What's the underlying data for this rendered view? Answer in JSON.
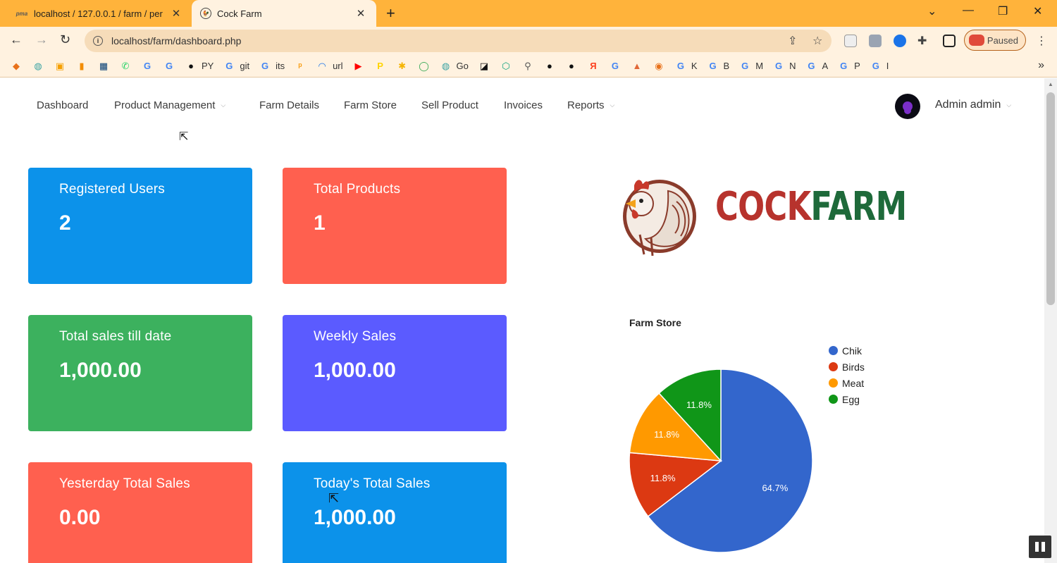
{
  "browser": {
    "tabs": [
      {
        "title": "localhost / 127.0.0.1 / farm / per",
        "favicon": "phpmyadmin-icon",
        "active": false
      },
      {
        "title": "Cock Farm",
        "favicon": "rooster-icon",
        "active": true
      }
    ],
    "url": "localhost/farm/dashboard.php",
    "profile_status": "Paused",
    "bookmarks": [
      {
        "icon": "arrows-icon",
        "label": "",
        "color": "#e8711a"
      },
      {
        "icon": "leaf-icon",
        "label": "",
        "color": "#3aa3a3"
      },
      {
        "icon": "ui-icon",
        "label": "",
        "color": "#f59f00"
      },
      {
        "icon": "bars-icon",
        "label": "",
        "color": "#f28c00"
      },
      {
        "icon": "ieee-icon",
        "label": "",
        "color": "#003b73"
      },
      {
        "icon": "whatsapp-icon",
        "label": "",
        "color": "#25d366"
      },
      {
        "icon": "google-icon",
        "label": "",
        "color": "#4285f4"
      },
      {
        "icon": "google-icon",
        "label": "",
        "color": "#4285f4"
      },
      {
        "icon": "github-icon",
        "label": "PY",
        "color": "#111111"
      },
      {
        "icon": "google-icon",
        "label": "git",
        "color": "#4285f4"
      },
      {
        "icon": "google-icon",
        "label": "its",
        "color": "#4285f4"
      },
      {
        "icon": "pma-icon",
        "label": "",
        "color": "#f89c0e"
      },
      {
        "icon": "wave-icon",
        "label": "url",
        "color": "#1a73e8"
      },
      {
        "icon": "youtube-icon",
        "label": "",
        "color": "#ff0000"
      },
      {
        "icon": "p-icon",
        "label": "",
        "color": "#ffd400"
      },
      {
        "icon": "puzzle-icon",
        "label": "",
        "color": "#f5b400"
      },
      {
        "icon": "circle-icon",
        "label": "",
        "color": "#34a853"
      },
      {
        "icon": "leaf-icon",
        "label": "Go",
        "color": "#3aa3a3"
      },
      {
        "icon": "notion-icon",
        "label": "",
        "color": "#111111"
      },
      {
        "icon": "cube-icon",
        "label": "",
        "color": "#10a37f"
      },
      {
        "icon": "figure-icon",
        "label": "",
        "color": "#555555"
      },
      {
        "icon": "globe-icon",
        "label": "",
        "color": "#111111"
      },
      {
        "icon": "globe-icon",
        "label": "",
        "color": "#111111"
      },
      {
        "icon": "yandex-icon",
        "label": "",
        "color": "#fc3f1d"
      },
      {
        "icon": "google-icon",
        "label": "",
        "color": "#4285f4"
      },
      {
        "icon": "matlab-icon",
        "label": "",
        "color": "#e16737"
      },
      {
        "icon": "eye-icon",
        "label": "",
        "color": "#e8711a"
      },
      {
        "icon": "google-icon",
        "label": "K",
        "color": "#4285f4"
      },
      {
        "icon": "google-icon",
        "label": "B",
        "color": "#4285f4"
      },
      {
        "icon": "google-icon",
        "label": "M",
        "color": "#4285f4"
      },
      {
        "icon": "google-icon",
        "label": "N",
        "color": "#4285f4"
      },
      {
        "icon": "google-icon",
        "label": "A",
        "color": "#4285f4"
      },
      {
        "icon": "google-icon",
        "label": "P",
        "color": "#4285f4"
      },
      {
        "icon": "google-icon",
        "label": "I",
        "color": "#4285f4"
      }
    ]
  },
  "nav": {
    "items": [
      {
        "label": "Dashboard",
        "dropdown": false
      },
      {
        "label": "Product Management",
        "dropdown": true
      },
      {
        "label": "Farm Details",
        "dropdown": false
      },
      {
        "label": "Farm Store",
        "dropdown": false
      },
      {
        "label": "Sell Product",
        "dropdown": false
      },
      {
        "label": "Invoices",
        "dropdown": false
      },
      {
        "label": "Reports",
        "dropdown": true
      }
    ],
    "user": "Admin admin"
  },
  "cards": [
    {
      "label": "Registered Users",
      "value": "2",
      "color": "#0c92ea"
    },
    {
      "label": "Total Products",
      "value": "1",
      "color": "#ff604f"
    },
    {
      "label": "Total sales till date",
      "value": "1,000.00",
      "color": "#3cb15e"
    },
    {
      "label": "Weekly Sales",
      "value": "1,000.00",
      "color": "#5b5bff"
    },
    {
      "label": "Yesterday Total Sales",
      "value": "0.00",
      "color": "#ff604f"
    },
    {
      "label": "Today's Total Sales",
      "value": "1,000.00",
      "color": "#0c92ea"
    }
  ],
  "logo": {
    "part1": "COCK",
    "part2": "FARM"
  },
  "chart_data": {
    "type": "pie",
    "title": "Farm Store",
    "slices": [
      {
        "label": "Chik",
        "value": 64.7,
        "display": "64.7%",
        "color": "#3366cc"
      },
      {
        "label": "Birds",
        "value": 11.8,
        "display": "11.8%",
        "color": "#dc3912"
      },
      {
        "label": "Meat",
        "value": 11.8,
        "display": "11.8%",
        "color": "#ff9900"
      },
      {
        "label": "Egg",
        "value": 11.8,
        "display": "11.8%",
        "color": "#109618"
      }
    ],
    "legend_position": "right"
  }
}
